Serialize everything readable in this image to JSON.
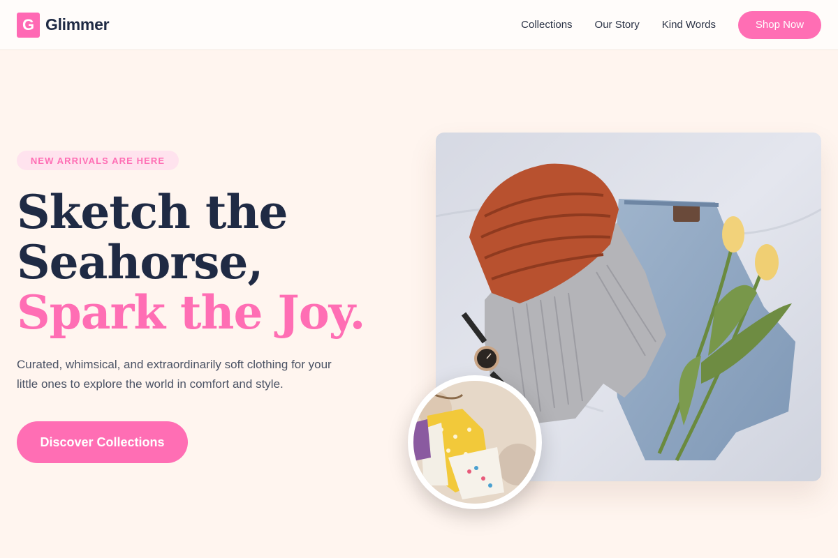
{
  "brand": {
    "logo_letter": "G",
    "name": "Glimmer",
    "accent": "#ff6eb4"
  },
  "nav": {
    "links": [
      "Collections",
      "Our Story",
      "Kind Words"
    ],
    "cta_label": "Shop Now"
  },
  "hero": {
    "badge": "NEW ARRIVALS ARE HERE",
    "headline_line1": "Sketch the",
    "headline_line2": "Seahorse,",
    "headline_accent": "Spark the Joy.",
    "subtext": "Curated, whimsical, and extraordinarily soft clothing for your little ones to explore the world in comfort and style.",
    "cta_label": "Discover Collections"
  },
  "images": {
    "main_alt": "Flat lay of knitted beanie, grey sweater, jeans, watch and yellow tulips",
    "round_alt": "Colorful children's clothes on hangers"
  },
  "colors": {
    "background": "#fff5ef",
    "heading": "#1f2a44",
    "accent": "#ff6eb4",
    "badge_bg": "#ffe3ee"
  }
}
